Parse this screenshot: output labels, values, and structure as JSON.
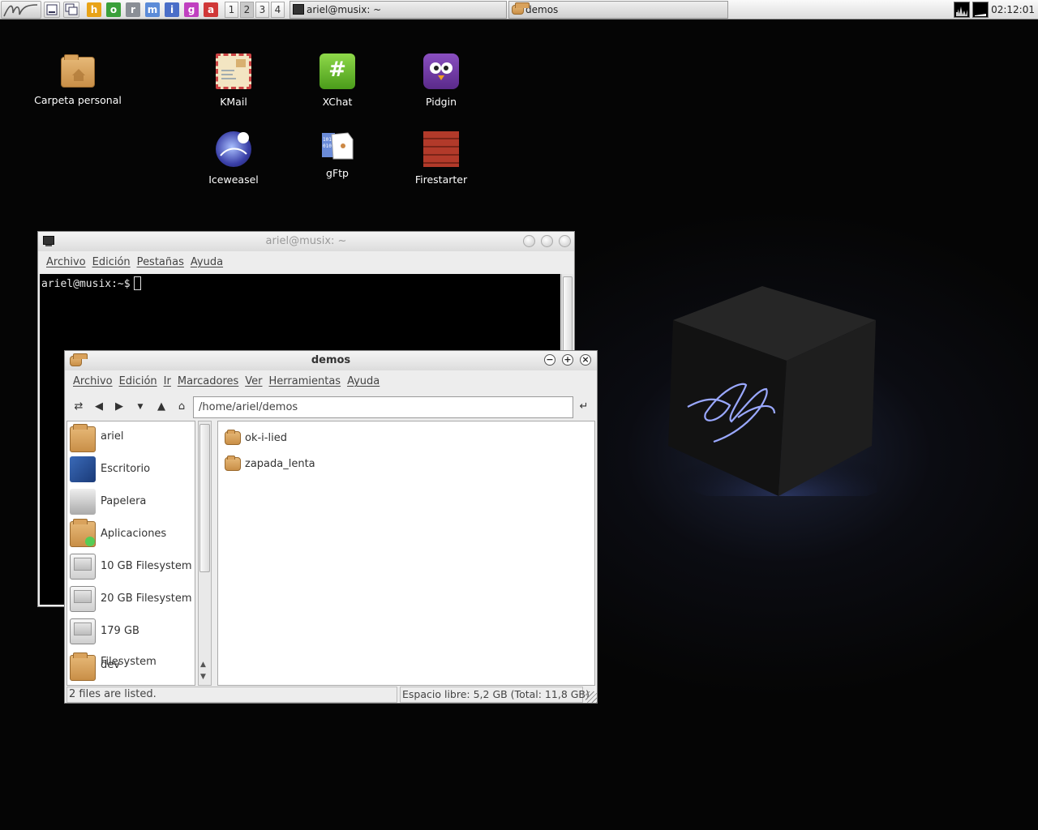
{
  "taskbar": {
    "launchers": [
      {
        "name": "h",
        "color": "#e8a317"
      },
      {
        "name": "o",
        "color": "#3aa03a"
      },
      {
        "name": "r",
        "color": "#8a8f96"
      },
      {
        "name": "m",
        "color": "#5b8bd8"
      },
      {
        "name": "i",
        "color": "#4a6ec8"
      },
      {
        "name": "g",
        "color": "#c040c0"
      },
      {
        "name": "a",
        "color": "#d03838"
      }
    ],
    "workspaces": [
      "1",
      "2",
      "3",
      "4"
    ],
    "active_workspace": "2",
    "tasks": [
      {
        "label": "ariel@musix: ~",
        "icon": "terminal-icon"
      },
      {
        "label": "demos",
        "icon": "folder-icon"
      }
    ],
    "clock": "02:12:01"
  },
  "desktop": {
    "icons": [
      {
        "label": "Carpeta personal",
        "icon": "home-folder-icon"
      },
      {
        "label": "KMail",
        "icon": "kmail-icon"
      },
      {
        "label": "XChat",
        "icon": "xchat-icon"
      },
      {
        "label": "Pidgin",
        "icon": "pidgin-icon"
      },
      {
        "label": "Iceweasel",
        "icon": "iceweasel-icon"
      },
      {
        "label": "gFtp",
        "icon": "gftp-icon"
      },
      {
        "label": "Firestarter",
        "icon": "firestarter-icon"
      }
    ]
  },
  "terminal": {
    "title": "ariel@musix: ~",
    "menu": [
      "Archivo",
      "Edición",
      "Pestañas",
      "Ayuda"
    ],
    "prompt": "ariel@musix:~$"
  },
  "filemanager": {
    "title": "demos",
    "menu": [
      "Archivo",
      "Edición",
      "Ir",
      "Marcadores",
      "Ver",
      "Herramientas",
      "Ayuda"
    ],
    "location": "/home/ariel/demos",
    "sidebar": [
      {
        "label": "ariel",
        "icon": "home-folder-icon"
      },
      {
        "label": "Escritorio",
        "icon": "desktop-icon"
      },
      {
        "label": "Papelera",
        "icon": "trash-icon"
      },
      {
        "label": "Aplicaciones",
        "icon": "applications-icon"
      },
      {
        "label": "10 GB Filesystem",
        "icon": "drive-icon"
      },
      {
        "label": "20 GB Filesystem",
        "icon": "drive-icon"
      },
      {
        "label": "179 GB Filesystem",
        "icon": "drive-icon"
      },
      {
        "label": "dev",
        "icon": "folder-icon"
      }
    ],
    "files": [
      {
        "label": "ok-i-lied",
        "icon": "folder-icon"
      },
      {
        "label": "zapada_lenta",
        "icon": "folder-icon"
      }
    ],
    "status_left": "2 files are listed.",
    "status_right": "Espacio libre: 5,2 GB (Total: 11,8 GB)"
  }
}
